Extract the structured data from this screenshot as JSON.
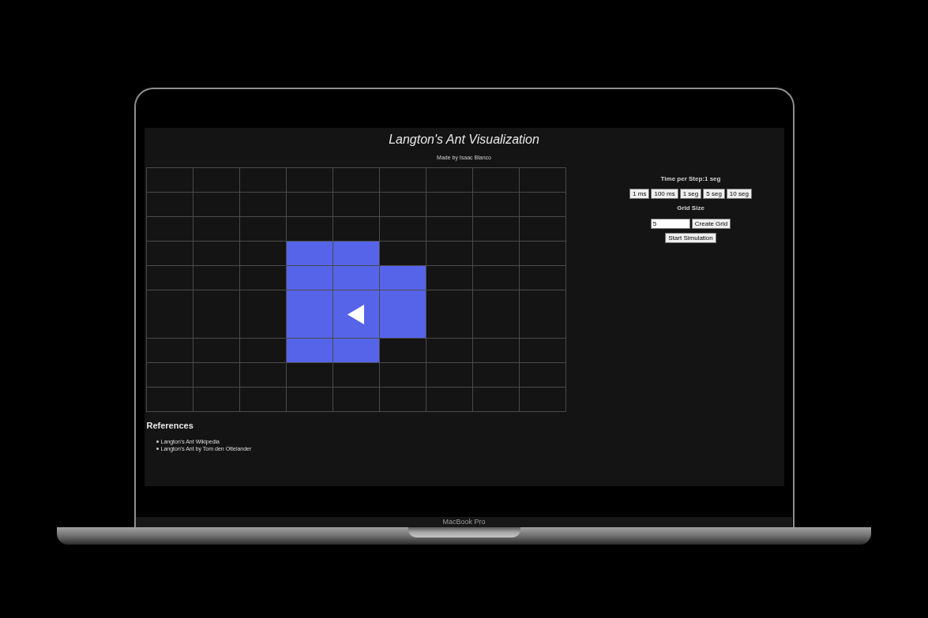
{
  "laptop": {
    "brand_label": "MacBook Pro"
  },
  "page": {
    "title": "Langton's Ant Visualization",
    "subtitle": "Made by Isaac Blanco"
  },
  "grid": {
    "rows": [
      {
        "cells": [
          {
            "filled": false
          },
          {
            "filled": false
          },
          {
            "filled": false
          },
          {
            "filled": false
          },
          {
            "filled": false
          },
          {
            "filled": false
          },
          {
            "filled": false
          },
          {
            "filled": false
          },
          {
            "filled": false
          }
        ]
      },
      {
        "cells": [
          {
            "filled": false
          },
          {
            "filled": false
          },
          {
            "filled": false
          },
          {
            "filled": false
          },
          {
            "filled": false
          },
          {
            "filled": false
          },
          {
            "filled": false
          },
          {
            "filled": false
          },
          {
            "filled": false
          }
        ]
      },
      {
        "cells": [
          {
            "filled": false
          },
          {
            "filled": false
          },
          {
            "filled": false
          },
          {
            "filled": false
          },
          {
            "filled": false
          },
          {
            "filled": false
          },
          {
            "filled": false
          },
          {
            "filled": false
          },
          {
            "filled": false
          }
        ]
      },
      {
        "cells": [
          {
            "filled": false
          },
          {
            "filled": false
          },
          {
            "filled": false
          },
          {
            "filled": true
          },
          {
            "filled": true
          },
          {
            "filled": false
          },
          {
            "filled": false
          },
          {
            "filled": false
          },
          {
            "filled": false
          }
        ]
      },
      {
        "cells": [
          {
            "filled": false
          },
          {
            "filled": false
          },
          {
            "filled": false
          },
          {
            "filled": true
          },
          {
            "filled": true
          },
          {
            "filled": true
          },
          {
            "filled": false
          },
          {
            "filled": false
          },
          {
            "filled": false
          }
        ]
      },
      {
        "cells": [
          {
            "filled": false
          },
          {
            "filled": false
          },
          {
            "filled": false
          },
          {
            "filled": true
          },
          {
            "filled": true,
            "ant": true
          },
          {
            "filled": true
          },
          {
            "filled": false
          },
          {
            "filled": false
          },
          {
            "filled": false
          }
        ]
      },
      {
        "cells": [
          {
            "filled": false
          },
          {
            "filled": false
          },
          {
            "filled": false
          },
          {
            "filled": true
          },
          {
            "filled": true
          },
          {
            "filled": false
          },
          {
            "filled": false
          },
          {
            "filled": false
          },
          {
            "filled": false
          }
        ]
      },
      {
        "cells": [
          {
            "filled": false
          },
          {
            "filled": false
          },
          {
            "filled": false
          },
          {
            "filled": false
          },
          {
            "filled": false
          },
          {
            "filled": false
          },
          {
            "filled": false
          },
          {
            "filled": false
          },
          {
            "filled": false
          }
        ]
      },
      {
        "cells": [
          {
            "filled": false
          },
          {
            "filled": false
          },
          {
            "filled": false
          },
          {
            "filled": false
          },
          {
            "filled": false
          },
          {
            "filled": false
          },
          {
            "filled": false
          },
          {
            "filled": false
          },
          {
            "filled": false
          }
        ]
      }
    ]
  },
  "controls": {
    "time_label": "Time per Step:1 seg",
    "speed_buttons": [
      "1 ms",
      "100 ms",
      "1 seg",
      "5 seg",
      "10 seg"
    ],
    "grid_size_label": "Grid Size",
    "grid_size_input": {
      "value": "5"
    },
    "create_button": "Create Grid",
    "start_button": "Start Simulation"
  },
  "references": {
    "heading": "References",
    "links": [
      "Langton's Ant Wikipedia",
      "Langton's Ant by Tom den Ottelander"
    ]
  }
}
